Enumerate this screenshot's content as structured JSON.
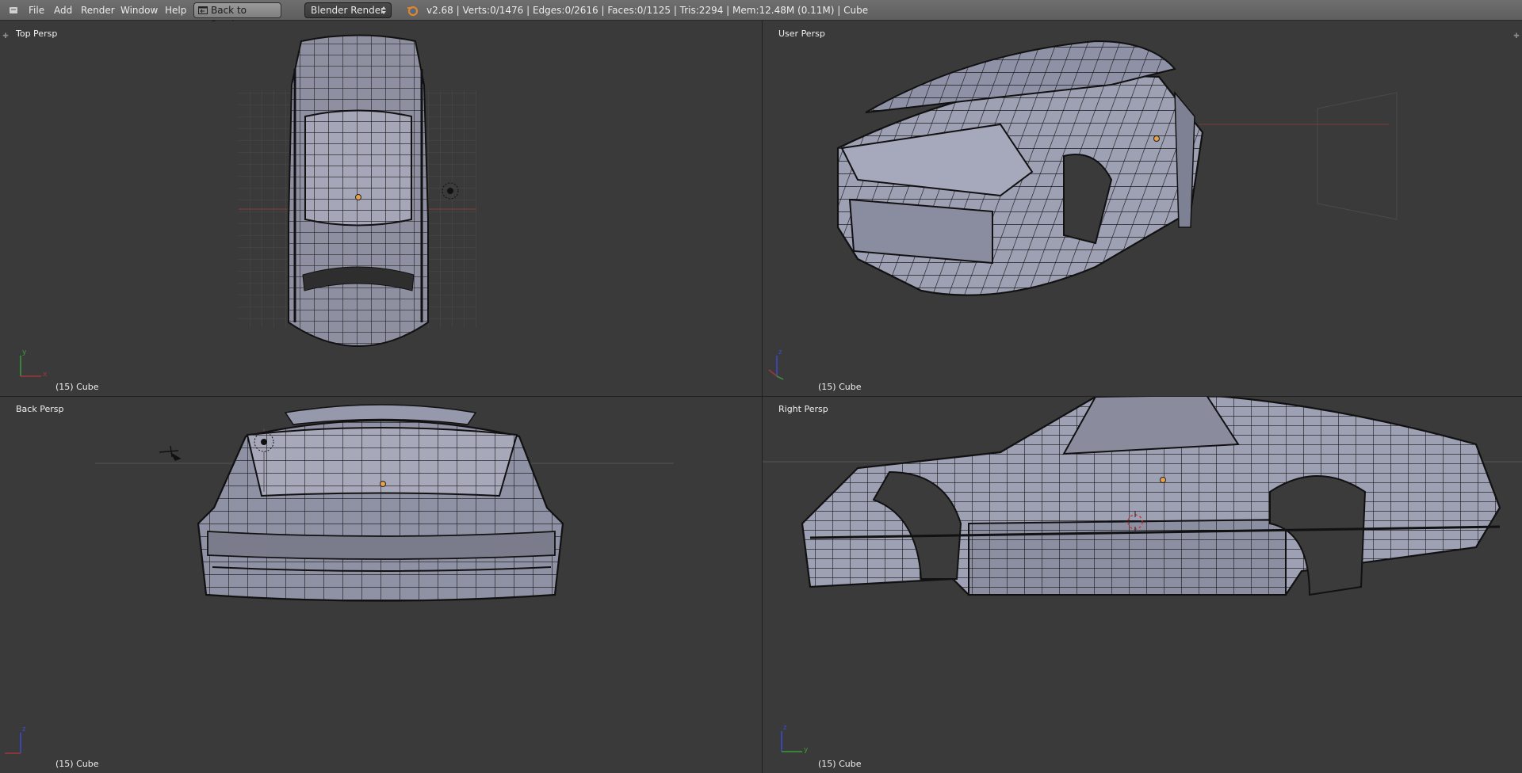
{
  "header": {
    "menu": [
      {
        "label": "File"
      },
      {
        "label": "Add"
      },
      {
        "label": "Render"
      },
      {
        "label": "Window"
      },
      {
        "label": "Help"
      }
    ],
    "back_button_label": "Back to Previous",
    "render_engine": "Blender Render",
    "stats": "v2.68 | Verts:0/1476 | Edges:0/2616 | Faces:0/1125 | Tris:2294 | Mem:12.48M (0.11M) | Cube"
  },
  "viewports": [
    {
      "label": "Top Persp",
      "object": "(15) Cube"
    },
    {
      "label": "User Persp",
      "object": "(15) Cube"
    },
    {
      "label": "Back Persp",
      "object": "(15) Cube"
    },
    {
      "label": "Right Persp",
      "object": "(15) Cube"
    }
  ],
  "colors": {
    "mesh_face": "#9ea0b4",
    "mesh_edge": "#111111",
    "grid": "#4b4b4b",
    "axis_x": "#a03838",
    "axis_y": "#3a9a3a",
    "axis_z": "#3a4ad0",
    "origin": "#e8a04a"
  },
  "icons": {
    "editor_type": "window-menu-icon",
    "back": "back-to-previous-icon",
    "engine_logo": "blender-logo-icon"
  }
}
